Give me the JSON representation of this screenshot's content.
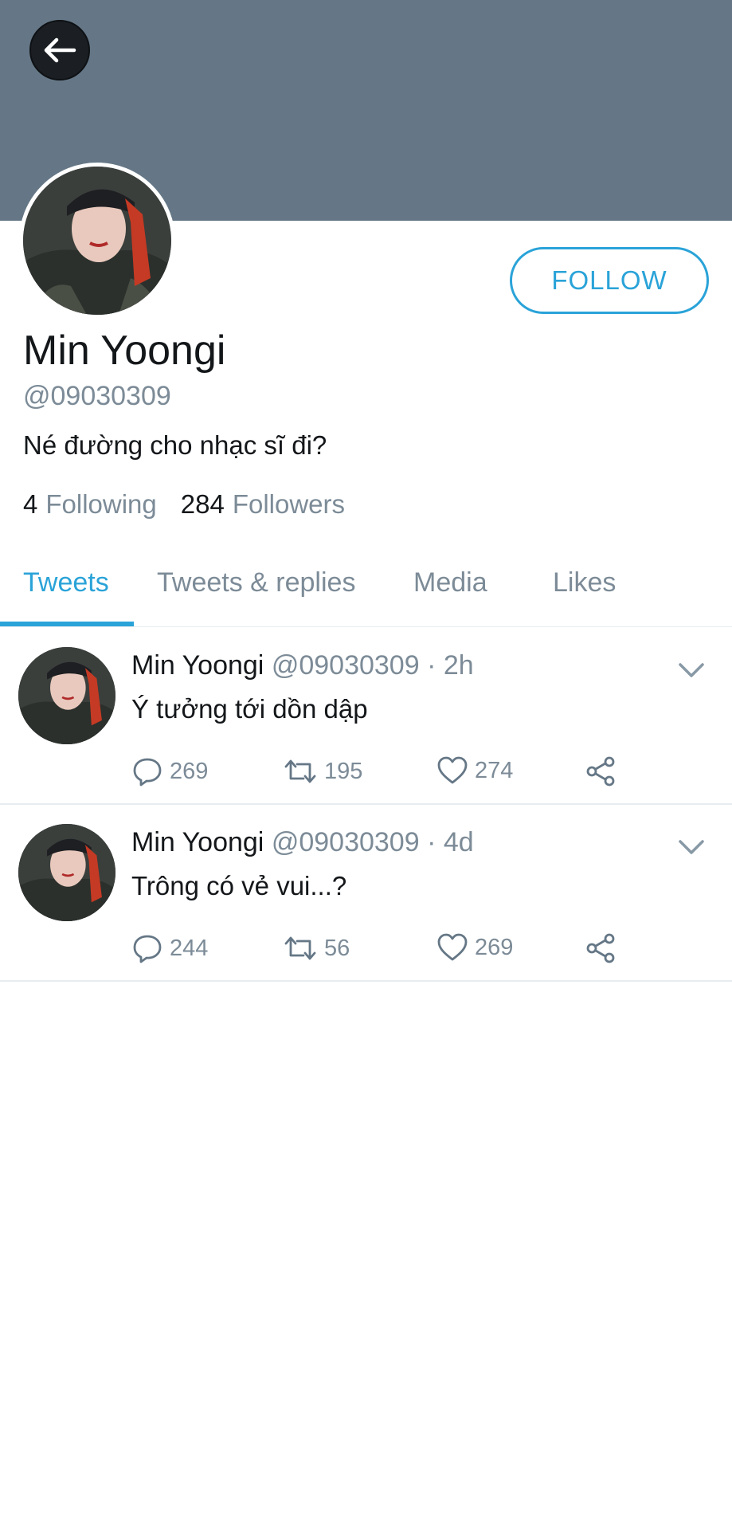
{
  "profile": {
    "display_name": "Min Yoongi",
    "handle": "@09030309",
    "bio": "Né đường cho nhạc sĩ đi?",
    "following_count": "4",
    "following_label": "Following",
    "followers_count": "284",
    "followers_label": "Followers",
    "follow_label": "FOLLOW"
  },
  "tabs": [
    {
      "label": "Tweets",
      "active": true
    },
    {
      "label": "Tweets & replies",
      "active": false
    },
    {
      "label": "Media",
      "active": false
    },
    {
      "label": "Likes",
      "active": false
    }
  ],
  "tweets": [
    {
      "name": "Min Yoongi",
      "handle_time": "@09030309 · 2h",
      "text": "Ý tưởng tới dồn dập",
      "replies": "269",
      "retweets": "195",
      "likes": "274"
    },
    {
      "name": "Min Yoongi",
      "handle_time": "@09030309 · 4d",
      "text": "Trông có vẻ vui...?",
      "replies": "244",
      "retweets": "56",
      "likes": "269"
    }
  ],
  "colors": {
    "banner": "#657786",
    "accent": "#2aa3d8",
    "secondary_text": "#7c8b97"
  },
  "icons": [
    "back-arrow-icon",
    "reply-icon",
    "retweet-icon",
    "like-icon",
    "share-icon",
    "chevron-down-icon"
  ]
}
